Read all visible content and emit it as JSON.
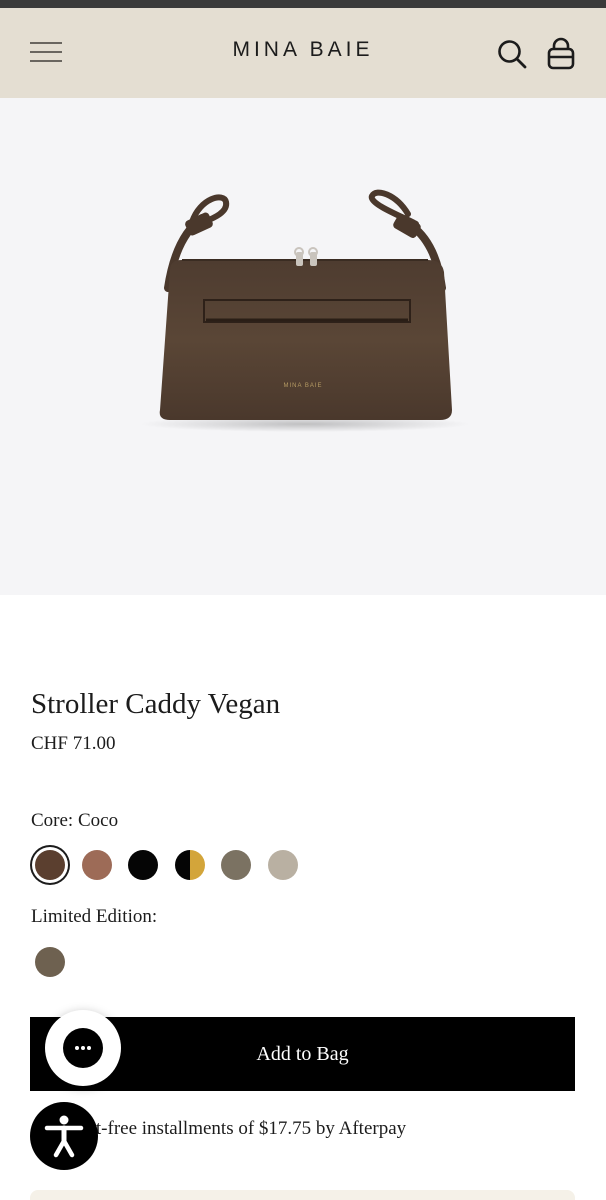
{
  "header": {
    "brand": "MINA BAIE",
    "menu_icon": "hamburger-menu-icon",
    "search_icon": "search-icon",
    "cart_icon": "shopping-bag-icon"
  },
  "gallery": {
    "background": "#f5f5f7"
  },
  "product": {
    "title": "Stroller Caddy Vegan",
    "price": "CHF 71.00",
    "logo_text": "MINA BAIE"
  },
  "options": {
    "core_label": "Core: Coco",
    "core_swatches": [
      {
        "color": "#5b3f2f",
        "selected": true
      },
      {
        "color": "#9d6b57",
        "selected": false
      },
      {
        "color": "#050505",
        "selected": false
      },
      {
        "color": "split:#050505|#d3a53a",
        "selected": false
      },
      {
        "color": "#7b7262",
        "selected": false
      },
      {
        "color": "#b9b0a2",
        "selected": false
      }
    ],
    "limited_label": "Limited Edition:",
    "limited_swatches": [
      {
        "color": "#6e6150",
        "selected": false
      }
    ]
  },
  "cta": {
    "add_to_bag": "Add to Bag"
  },
  "afterpay": {
    "text": "4 interest-free installments of $17.75 by Afterpay"
  },
  "widgets": {
    "chat_icon": "chat-bubble-icon",
    "accessibility_icon": "accessibility-icon"
  },
  "colors": {
    "header_bg": "#e4ded2",
    "button_bg": "#000000",
    "text": "#1c1c1c"
  }
}
